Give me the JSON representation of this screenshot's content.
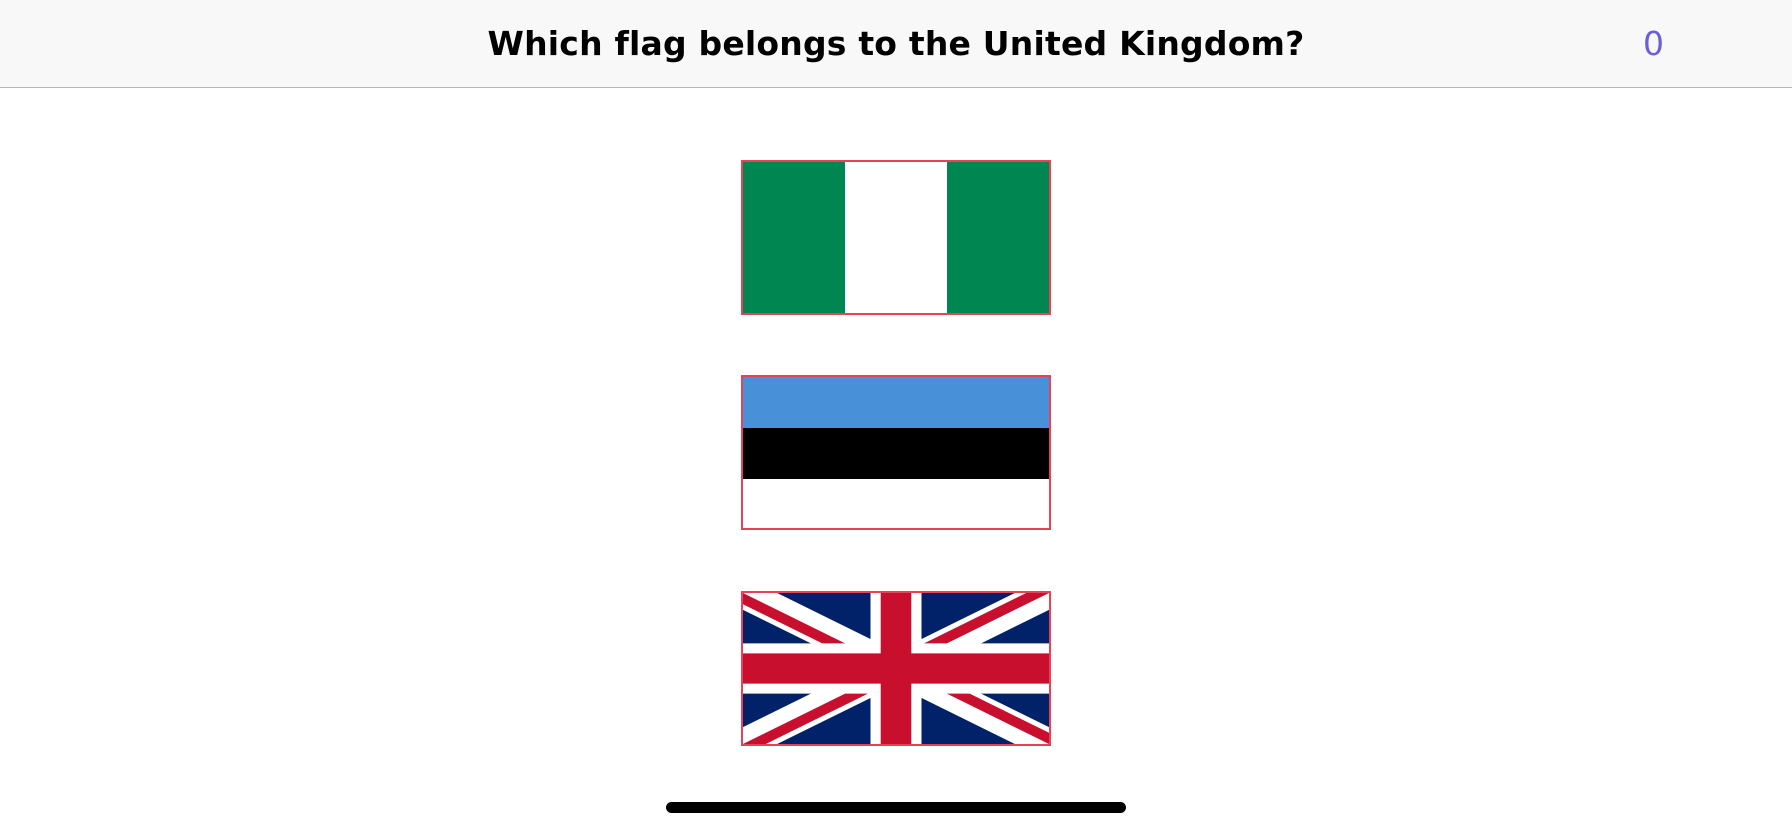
{
  "navbar": {
    "title": "Which flag belongs to the United Kingdom?",
    "score": "0",
    "score_color": "#6b5fd6"
  },
  "flags": [
    {
      "icon": "nigeria-flag-icon",
      "colors": [
        "#008751",
        "#ffffff",
        "#008751"
      ]
    },
    {
      "icon": "estonia-flag-icon",
      "colors": [
        "#4891d9",
        "#000000",
        "#ffffff"
      ]
    },
    {
      "icon": "united-kingdom-flag-icon",
      "colors": [
        "#012169",
        "#ffffff",
        "#c8102e"
      ]
    }
  ],
  "accent": {
    "button_border": "#e8415a"
  }
}
